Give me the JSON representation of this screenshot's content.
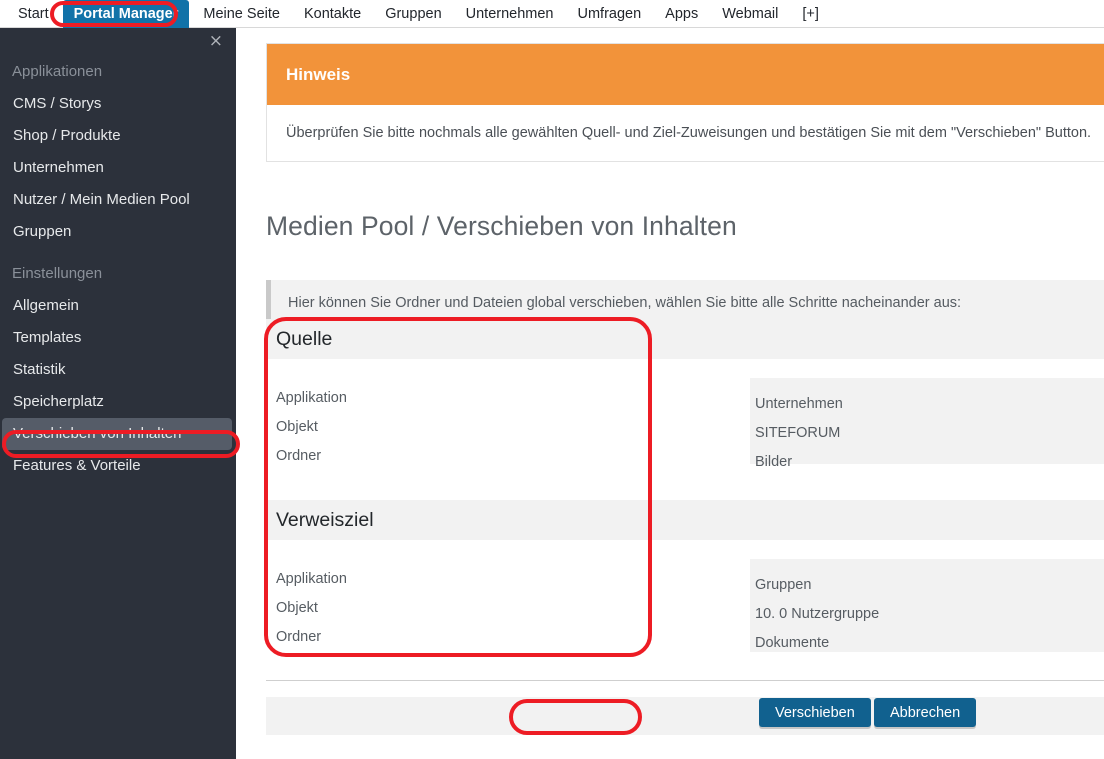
{
  "nav": {
    "items": [
      {
        "label": "Start",
        "active": false
      },
      {
        "label": "Portal Manager",
        "active": true
      },
      {
        "label": "Meine Seite",
        "active": false
      },
      {
        "label": "Kontakte",
        "active": false
      },
      {
        "label": "Gruppen",
        "active": false
      },
      {
        "label": "Unternehmen",
        "active": false
      },
      {
        "label": "Umfragen",
        "active": false
      },
      {
        "label": "Apps",
        "active": false
      },
      {
        "label": "Webmail",
        "active": false
      },
      {
        "label": "[+]",
        "active": false
      }
    ]
  },
  "sidebar": {
    "close_icon": "×",
    "groups": [
      {
        "title": "Applikationen",
        "items": [
          {
            "label": "CMS / Storys",
            "selected": false
          },
          {
            "label": "Shop / Produkte",
            "selected": false
          },
          {
            "label": "Unternehmen",
            "selected": false
          },
          {
            "label": "Nutzer / Mein Medien Pool",
            "selected": false
          },
          {
            "label": "Gruppen",
            "selected": false
          }
        ]
      },
      {
        "title": "Einstellungen",
        "items": [
          {
            "label": "Allgemein",
            "selected": false
          },
          {
            "label": "Templates",
            "selected": false
          },
          {
            "label": "Statistik",
            "selected": false
          },
          {
            "label": "Speicherplatz",
            "selected": false
          },
          {
            "label": "Verschieben von Inhalten",
            "selected": true
          },
          {
            "label": "Features & Vorteile",
            "selected": false
          }
        ]
      }
    ]
  },
  "notice": {
    "title": "Hinweis",
    "body": "Überprüfen Sie bitte nochmals alle gewählten Quell- und Ziel-Zuweisungen und bestätigen Sie mit dem \"Verschieben\" Button."
  },
  "page": {
    "title": "Medien Pool / Verschieben von Inhalten",
    "info": "Hier können Sie Ordner und Dateien global verschieben, wählen Sie bitte alle Schritte nacheinander aus:"
  },
  "sections": [
    {
      "heading": "Quelle",
      "labels": [
        "Applikation",
        "Objekt",
        "Ordner"
      ],
      "values": [
        "Unternehmen",
        "SITEFORUM",
        "Bilder"
      ]
    },
    {
      "heading": "Verweisziel",
      "labels": [
        "Applikation",
        "Objekt",
        "Ordner"
      ],
      "values": [
        "Gruppen",
        "10. 0 Nutzergruppe",
        "Dokumente"
      ]
    }
  ],
  "buttons": {
    "submit": "Verschieben",
    "cancel": "Abbrechen"
  },
  "colors": {
    "accent_blue": "#11618f",
    "notice_orange": "#f2933a",
    "sidebar_dark": "#2c313b",
    "band_gray": "#f2f2f2",
    "annotation_red": "#ed1c24"
  },
  "annotations": [
    {
      "name": "portal-manager-highlight"
    },
    {
      "name": "sidebar-item-highlight"
    },
    {
      "name": "form-sections-highlight"
    },
    {
      "name": "submit-button-highlight"
    }
  ]
}
